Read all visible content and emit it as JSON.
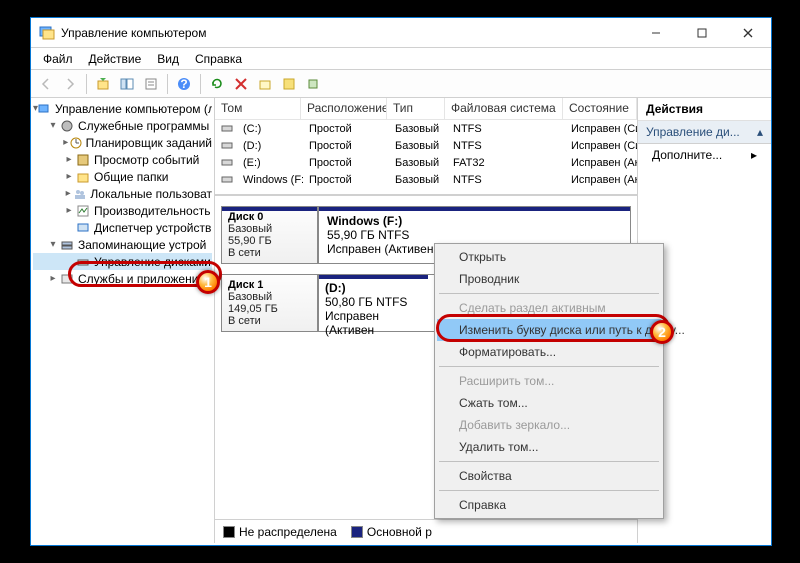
{
  "window": {
    "title": "Управление компьютером"
  },
  "menu": {
    "file": "Файл",
    "action": "Действие",
    "view": "Вид",
    "help": "Справка"
  },
  "tree": {
    "root": "Управление компьютером (л",
    "system_tools": "Служебные программы",
    "task_scheduler": "Планировщик заданий",
    "event_viewer": "Просмотр событий",
    "shared_folders": "Общие папки",
    "local_users": "Локальные пользоват",
    "perf": "Производительность",
    "devmgr": "Диспетчер устройств",
    "storage": "Запоминающие устрой",
    "diskmgmt": "Управление дисками",
    "services": "Службы и приложения"
  },
  "vol_headers": {
    "volume": "Том",
    "layout": "Расположение",
    "type": "Тип",
    "fs": "Файловая система",
    "status": "Состояние"
  },
  "volumes": [
    {
      "name": "(C:)",
      "layout": "Простой",
      "type": "Базовый",
      "fs": "NTFS",
      "status": "Исправен (Си"
    },
    {
      "name": "(D:)",
      "layout": "Простой",
      "type": "Базовый",
      "fs": "NTFS",
      "status": "Исправен (Си"
    },
    {
      "name": "(E:)",
      "layout": "Простой",
      "type": "Базовый",
      "fs": "FAT32",
      "status": "Исправен (Ак"
    },
    {
      "name": "Windows (F:)",
      "layout": "Простой",
      "type": "Базовый",
      "fs": "NTFS",
      "status": "Исправен (Ак"
    }
  ],
  "disks": [
    {
      "label": "Диск 0",
      "type": "Базовый",
      "size": "55,90 ГБ",
      "online": "В сети",
      "parts": [
        {
          "title": "Windows  (F:)",
          "sub1": "55,90 ГБ NTFS",
          "sub2": "Исправен (Активен"
        }
      ]
    },
    {
      "label": "Диск 1",
      "type": "Базовый",
      "size": "149,05 ГБ",
      "online": "В сети",
      "parts": [
        {
          "title": "(D:)",
          "sub1": "50,80 ГБ NTFS",
          "sub2": "Исправен (Активен"
        }
      ]
    }
  ],
  "legend": {
    "unalloc": "Не распределена",
    "primary": "Основной р"
  },
  "actions": {
    "header": "Действия",
    "section": "Управление ди...",
    "more": "Дополните..."
  },
  "ctx": {
    "open": "Открыть",
    "explore": "Проводник",
    "mark_active": "Сделать раздел активным",
    "change_letter": "Изменить букву диска или путь к диску...",
    "format": "Форматировать...",
    "extend": "Расширить том...",
    "shrink": "Сжать том...",
    "mirror": "Добавить зеркало...",
    "delete": "Удалить том...",
    "props": "Свойства",
    "help": "Справка"
  },
  "callouts": {
    "one": "1",
    "two": "2"
  }
}
